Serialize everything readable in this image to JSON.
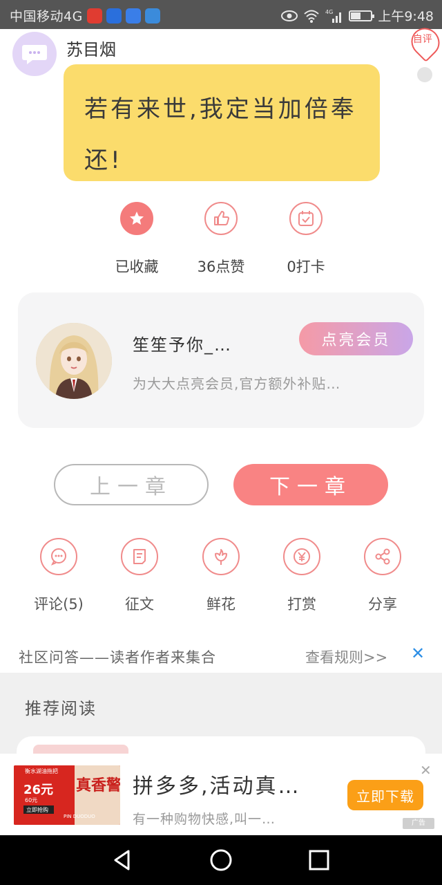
{
  "status_bar": {
    "carrier": "中国移动4G",
    "time": "上午9:48",
    "battery_level": 0.5,
    "app_icon_colors": [
      "#e03c31",
      "#2a6fdc",
      "#3a7ee8",
      "#3b8bdb"
    ]
  },
  "message": {
    "author": "苏目烟",
    "text": "若有来世,我定当加倍奉还!",
    "self_badge": "自评",
    "bubble_color": "#fbdc6c"
  },
  "actions": [
    {
      "label": "已收藏",
      "icon": "star-icon"
    },
    {
      "label": "36点赞",
      "icon": "thumbs-up-icon"
    },
    {
      "label": "0打卡",
      "icon": "calendar-check-icon"
    }
  ],
  "member": {
    "name": "笙笙予你_…",
    "description": "为大大点亮会员,官方额外补贴…",
    "button_label": "点亮会员"
  },
  "chapters": {
    "prev_label": "上一章",
    "next_label": "下一章"
  },
  "social": [
    {
      "label": "评论(5)",
      "icon": "comment-icon"
    },
    {
      "label": "征文",
      "icon": "document-icon"
    },
    {
      "label": "鲜花",
      "icon": "flower-icon"
    },
    {
      "label": "打赏",
      "icon": "yen-coin-icon"
    },
    {
      "label": "分享",
      "icon": "share-icon"
    }
  ],
  "community": {
    "text": "社区问答——读者作者来集合",
    "rules_link": "查看规则>>",
    "close": "✕"
  },
  "recommended": {
    "title": "推荐阅读"
  },
  "ad": {
    "title": "拼多多,活动真…",
    "subtitle": "有一种购物快感,叫一…",
    "button_label": "立即下载",
    "tag": "广告",
    "close": "✕",
    "image_price": "26元",
    "image_sub_price": "60元",
    "image_cta": "立即抢购",
    "image_headline": "真香警告",
    "image_brand": "PIN DUODUO",
    "image_top": "衡水湖油拖把"
  },
  "colors": {
    "accent": "#f98383",
    "icon_outline": "#f08b8b",
    "link_blue": "#2d8fe6",
    "ad_button": "#fb9f17"
  }
}
